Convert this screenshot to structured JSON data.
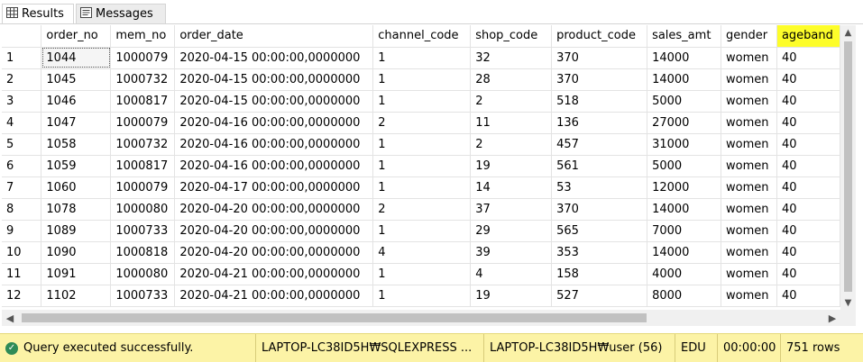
{
  "tabs": [
    {
      "label": "Results",
      "icon": "grid-icon"
    },
    {
      "label": "Messages",
      "icon": "messages-icon"
    }
  ],
  "grid": {
    "columns": [
      "order_no",
      "mem_no",
      "order_date",
      "channel_code",
      "shop_code",
      "product_code",
      "sales_amt",
      "gender",
      "ageband"
    ],
    "highlighted_column": "ageband",
    "highlight_color": "#fdfd2a",
    "rows": [
      {
        "n": "1",
        "cells": [
          "1044",
          "1000079",
          "2020-04-15 00:00:00,0000000",
          "1",
          "32",
          "370",
          "14000",
          "women",
          "40"
        ]
      },
      {
        "n": "2",
        "cells": [
          "1045",
          "1000732",
          "2020-04-15 00:00:00,0000000",
          "1",
          "28",
          "370",
          "14000",
          "women",
          "40"
        ]
      },
      {
        "n": "3",
        "cells": [
          "1046",
          "1000817",
          "2020-04-15 00:00:00,0000000",
          "1",
          "2",
          "518",
          "5000",
          "women",
          "40"
        ]
      },
      {
        "n": "4",
        "cells": [
          "1047",
          "1000079",
          "2020-04-16 00:00:00,0000000",
          "2",
          "11",
          "136",
          "27000",
          "women",
          "40"
        ]
      },
      {
        "n": "5",
        "cells": [
          "1058",
          "1000732",
          "2020-04-16 00:00:00,0000000",
          "1",
          "2",
          "457",
          "31000",
          "women",
          "40"
        ]
      },
      {
        "n": "6",
        "cells": [
          "1059",
          "1000817",
          "2020-04-16 00:00:00,0000000",
          "1",
          "19",
          "561",
          "5000",
          "women",
          "40"
        ]
      },
      {
        "n": "7",
        "cells": [
          "1060",
          "1000079",
          "2020-04-17 00:00:00,0000000",
          "1",
          "14",
          "53",
          "12000",
          "women",
          "40"
        ]
      },
      {
        "n": "8",
        "cells": [
          "1078",
          "1000080",
          "2020-04-20 00:00:00,0000000",
          "2",
          "37",
          "370",
          "14000",
          "women",
          "40"
        ]
      },
      {
        "n": "9",
        "cells": [
          "1089",
          "1000733",
          "2020-04-20 00:00:00,0000000",
          "1",
          "29",
          "565",
          "7000",
          "women",
          "40"
        ]
      },
      {
        "n": "10",
        "cells": [
          "1090",
          "1000818",
          "2020-04-20 00:00:00,0000000",
          "4",
          "39",
          "353",
          "14000",
          "women",
          "40"
        ]
      },
      {
        "n": "11",
        "cells": [
          "1091",
          "1000080",
          "2020-04-21 00:00:00,0000000",
          "1",
          "4",
          "158",
          "4000",
          "women",
          "40"
        ]
      },
      {
        "n": "12",
        "cells": [
          "1102",
          "1000733",
          "2020-04-21 00:00:00,0000000",
          "1",
          "19",
          "527",
          "8000",
          "women",
          "40"
        ]
      }
    ]
  },
  "status": {
    "message": "Query executed successfully.",
    "server": "LAPTOP-LC38ID5H₩SQLEXPRESS ...",
    "user": "LAPTOP-LC38ID5H₩user (56)",
    "database": "EDU",
    "elapsed": "00:00:00",
    "rows": "751 rows",
    "background": "#fcf3a6",
    "ok_color": "#2e8b57"
  }
}
